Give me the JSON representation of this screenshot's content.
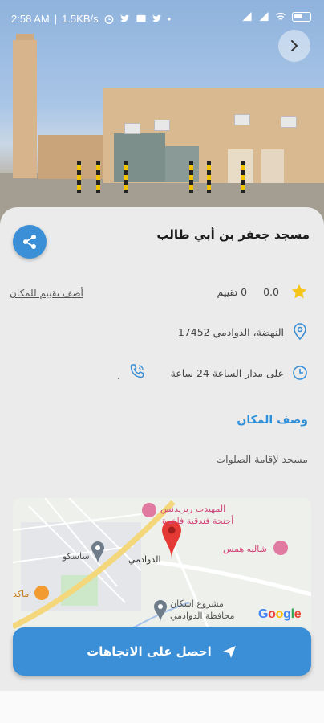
{
  "status_bar": {
    "time": "2:58 AM",
    "speed": "1.5KB/s"
  },
  "place": {
    "name": "مسجد جعفر بن أبي طالب",
    "rating_value": "0.0",
    "rating_count": "0 تقييم",
    "add_rating": "أضف تقييم للمكان",
    "address": "النهضة، الدوادمي 17452",
    "hours": "على مدار الساعة 24 ساعة",
    "phone": ".",
    "description_title": "وصف المكان",
    "description": "مسجد لإقامة الصلوات"
  },
  "map": {
    "labels": {
      "hotel": "المهيدب ريزيدنس",
      "hotel_sub": "أجنحة فندقية فاخرة",
      "chalet": "شاليه همس",
      "sasco": "ساسكو",
      "city": "الدوادمي",
      "maka": "ماكد",
      "housing": "مشروع اسكان",
      "housing_sub": "محافظة الدوادمي"
    },
    "attribution": "Google"
  },
  "cta": {
    "label": "احصل على الاتجاهات"
  },
  "colors": {
    "accent": "#3a8fd6",
    "star": "#f5c518",
    "pin": "#e53935"
  },
  "icons": [
    "back-icon",
    "share-icon",
    "star-icon",
    "location-icon",
    "clock-icon",
    "phone-icon",
    "send-icon"
  ]
}
